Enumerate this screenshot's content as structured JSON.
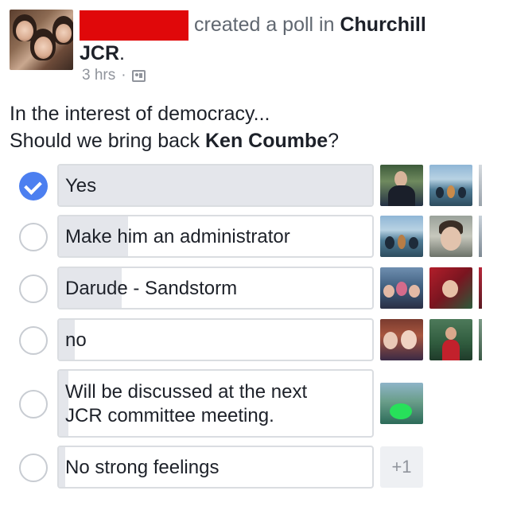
{
  "post": {
    "action_text": "created a poll in",
    "group_name_part1": "Churchill",
    "group_name_part2": "JCR",
    "period": ".",
    "time": "3 hrs",
    "separator": "·",
    "audience_icon": "group-audience-icon"
  },
  "question": {
    "line1": "In the interest of democracy...",
    "line2_prefix": "Should we bring back ",
    "line2_bold": "Ken Coumbe",
    "line2_suffix": "?"
  },
  "options": [
    {
      "label": "Yes",
      "selected": true,
      "vote_share": 1.0
    },
    {
      "label": "Make him an administrator",
      "selected": false,
      "vote_share": 0.22
    },
    {
      "label": "Darude - Sandstorm",
      "selected": false,
      "vote_share": 0.2
    },
    {
      "label": "no",
      "selected": false,
      "vote_share": 0.05
    },
    {
      "label": "Will be discussed at the next JCR committee meeting.",
      "selected": false,
      "vote_share": 0.03
    },
    {
      "label": "No strong feelings",
      "selected": false,
      "vote_share": 0.02
    }
  ],
  "more_voters": "+1",
  "colors": {
    "redaction": "#e0080a",
    "check_blue": "#4c7ff0",
    "bar_fill": "#e4e6eb",
    "bar_border": "#dadde1",
    "muted_text": "#90949c"
  }
}
